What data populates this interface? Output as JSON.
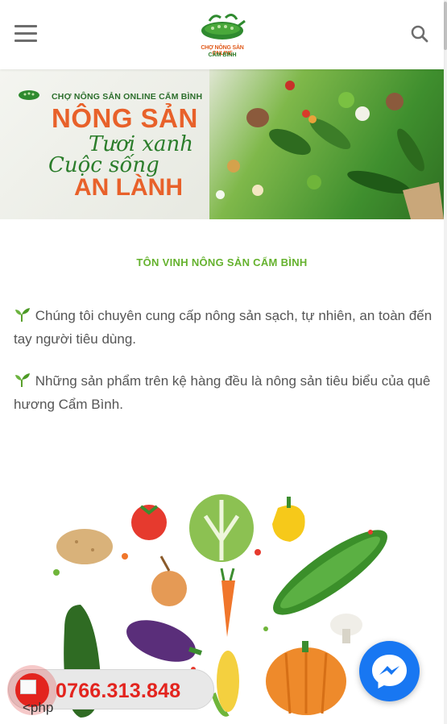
{
  "header": {
    "logo_line1": "CHỢ NÔNG SẢN ONLINE",
    "logo_line2": "CẨM BÌNH"
  },
  "banner": {
    "subtitle": "CHỢ NÔNG SẢN ONLINE CẨM BÌNH",
    "line1": "NÔNG SẢN",
    "line2": "Tươi xanh",
    "line3": "Cuộc sống",
    "line4": "AN LÀNH"
  },
  "content": {
    "section_title": "TÔN VINH NÔNG SẢN CẨM BÌNH",
    "paragraph1": "Chúng tôi chuyên cung cấp nông sản sạch, tự nhiên, an toàn đến tay người tiêu dùng.",
    "paragraph2": "Những sản phẩm trên kệ hàng đều là nông sản tiêu biểu của quê hương Cẩm Bình."
  },
  "callbar": {
    "phone": "0766.313.848",
    "broken_text": "<php"
  },
  "icons": {
    "menu": "hamburger-icon",
    "search": "search-icon",
    "sprout": "sprout-icon",
    "messenger": "messenger-icon",
    "phone": "phone-icon"
  },
  "colors": {
    "accent_green": "#65b22e",
    "brand_orange": "#e8612a",
    "call_red": "#e3241e",
    "messenger_blue": "#1877f2"
  }
}
